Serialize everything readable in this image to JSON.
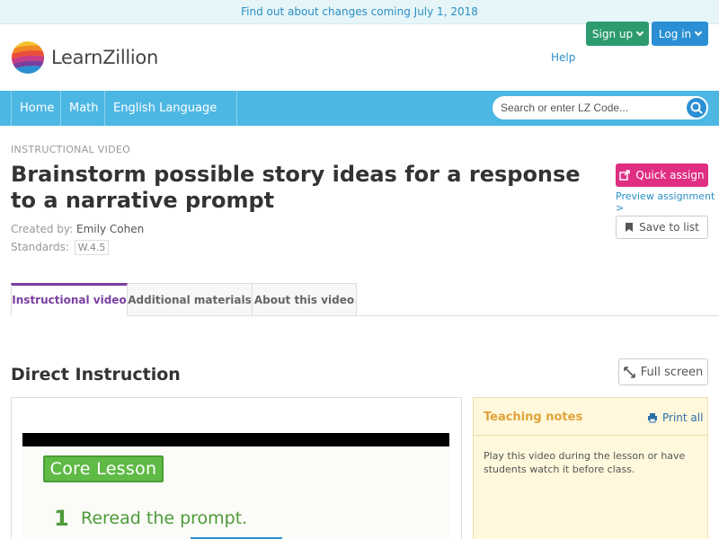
{
  "banner": {
    "text": "Find out about changes coming July 1, 2018"
  },
  "header": {
    "brand": "LearnZillion",
    "help": "Help",
    "signup": "Sign up",
    "login": "Log in"
  },
  "nav": {
    "items": [
      "Home",
      "Math",
      "English Language Arts"
    ],
    "search_placeholder": "Search or enter LZ Code..."
  },
  "lesson": {
    "eyebrow": "INSTRUCTIONAL VIDEO",
    "title": "Brainstorm possible story ideas for a response to a narrative prompt",
    "created_label": "Created by:",
    "created_by": "Emily Cohen",
    "standards_label": "Standards:",
    "standard": "W.4.5"
  },
  "actions": {
    "quick_assign": "Quick assign",
    "preview": "Preview assignment >",
    "save": "Save to list"
  },
  "tabs": [
    "Instructional video",
    "Additional materials",
    "About this video"
  ],
  "section": {
    "title": "Direct Instruction",
    "fullscreen": "Full screen"
  },
  "video": {
    "core_lesson": "Core Lesson",
    "step_number": "1",
    "step_text": "Reread the prompt."
  },
  "notes": {
    "title": "Teaching notes",
    "print": "Print all",
    "text": "Play this video during the lesson or have students watch it before class."
  },
  "colors": {
    "nav": "#4db7e4",
    "signup": "#2e9b6f",
    "login": "#2a8fd4",
    "quick_assign": "#e02e83",
    "active_tab": "#7a3fa0",
    "notes_bg": "#fff8dc",
    "notes_title": "#e0a33a"
  }
}
